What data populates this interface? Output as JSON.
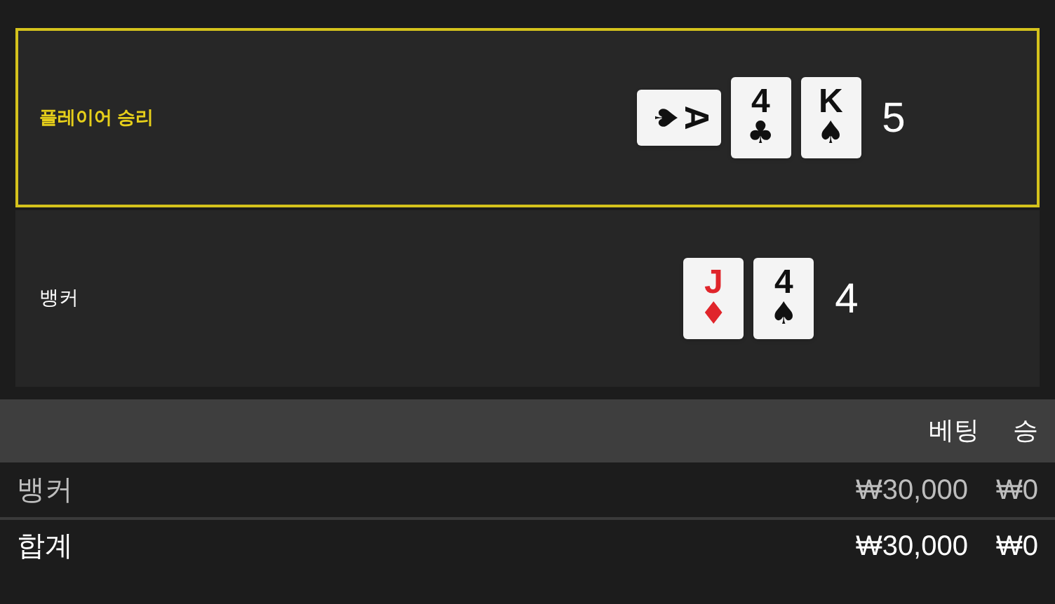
{
  "hands": [
    {
      "label": "플레이어 승리",
      "selected": true,
      "total": "5",
      "cards": [
        {
          "rank": "A",
          "suit": "♠",
          "color": "#111111",
          "rotated": true
        },
        {
          "rank": "4",
          "suit": "♣",
          "color": "#111111",
          "rotated": false
        },
        {
          "rank": "K",
          "suit": "♠",
          "color": "#111111",
          "rotated": false
        }
      ]
    },
    {
      "label": "뱅커",
      "selected": false,
      "total": "4",
      "cards": [
        {
          "rank": "J",
          "suit": "♦",
          "color": "#e0252b",
          "rotated": false
        },
        {
          "rank": "4",
          "suit": "♠",
          "color": "#111111",
          "rotated": false
        }
      ]
    }
  ],
  "table": {
    "columns": [
      "베팅",
      "승"
    ],
    "rows": [
      {
        "kind": "bet",
        "label": "뱅커",
        "cells": [
          "₩30,000",
          "₩0"
        ]
      },
      {
        "kind": "total",
        "label": "합계",
        "cells": [
          "₩30,000",
          "₩0"
        ]
      }
    ]
  }
}
